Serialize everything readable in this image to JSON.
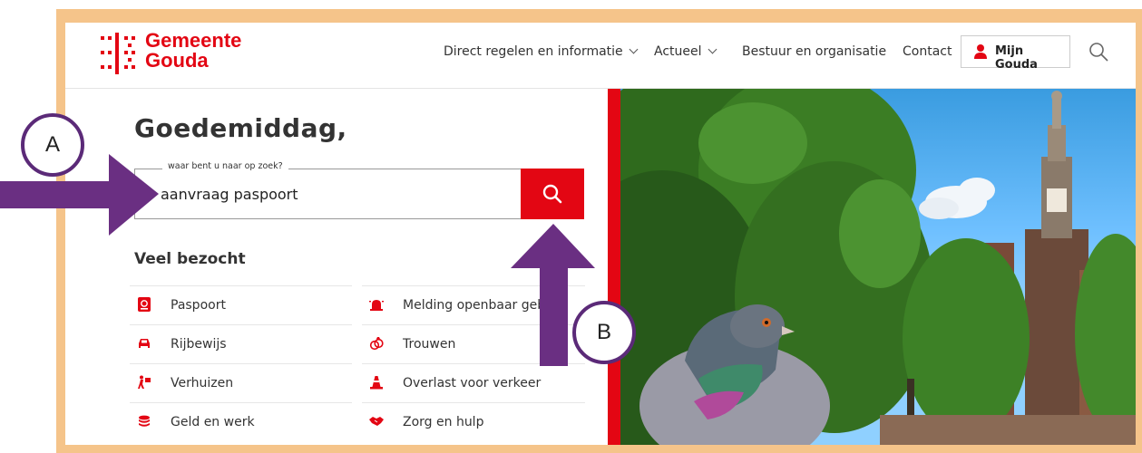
{
  "header": {
    "logo_line1": "Gemeente",
    "logo_line2": "Gouda",
    "nav": [
      {
        "label": "Direct regelen en informatie",
        "has_dropdown": true
      },
      {
        "label": "Actueel",
        "has_dropdown": true
      },
      {
        "label": "Bestuur en organisatie",
        "has_dropdown": false
      },
      {
        "label": "Contact",
        "has_dropdown": false
      }
    ],
    "account_label": "Mijn Gouda",
    "search_icon": "search-icon"
  },
  "main": {
    "greeting": "Goedemiddag,",
    "search": {
      "legend": "waar bent u naar op zoek?",
      "value": "aanvraag paspoort",
      "button_icon": "search-icon"
    },
    "popular_heading": "Veel bezocht",
    "popular_links": [
      {
        "label": "Paspoort",
        "icon": "passport-icon"
      },
      {
        "label": "Melding openbaar geb",
        "icon": "alarm-icon"
      },
      {
        "label": "Rijbewijs",
        "icon": "car-icon"
      },
      {
        "label": "Trouwen",
        "icon": "rings-icon"
      },
      {
        "label": "Verhuizen",
        "icon": "moving-icon"
      },
      {
        "label": "Overlast voor verkeer",
        "icon": "traffic-cone-icon"
      },
      {
        "label": "Geld en werk",
        "icon": "coins-icon"
      },
      {
        "label": "Zorg en hulp",
        "icon": "handshake-icon"
      }
    ]
  },
  "annotations": {
    "a": "A",
    "b": "B"
  },
  "colors": {
    "brand_red": "#e30613",
    "annotation_purple": "#5b2a78",
    "frame_orange": "#f5c48a"
  }
}
